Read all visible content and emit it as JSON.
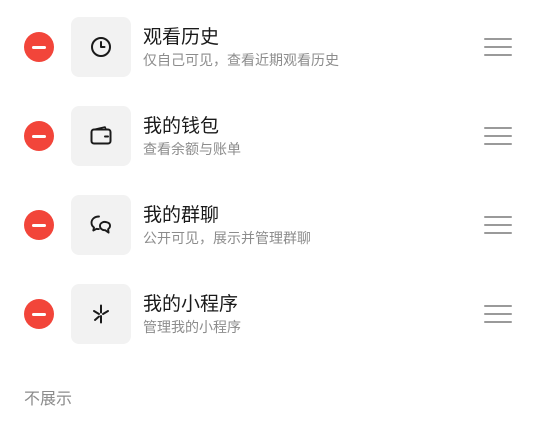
{
  "items": [
    {
      "title": "观看历史",
      "subtitle": "仅自己可见，查看近期观看历史",
      "icon": "clock-icon"
    },
    {
      "title": "我的钱包",
      "subtitle": "查看余额与账单",
      "icon": "wallet-icon"
    },
    {
      "title": "我的群聊",
      "subtitle": "公开可见，展示并管理群聊",
      "icon": "chat-bubbles-icon"
    },
    {
      "title": "我的小程序",
      "subtitle": "管理我的小程序",
      "icon": "mini-program-icon"
    }
  ],
  "hidden_section": {
    "label": "不展示"
  },
  "colors": {
    "remove": "#f2453a",
    "tile_bg": "#f2f2f2",
    "title": "#1a1a1a",
    "subtitle": "#8c8c8c",
    "handle": "#9a9a9a"
  }
}
